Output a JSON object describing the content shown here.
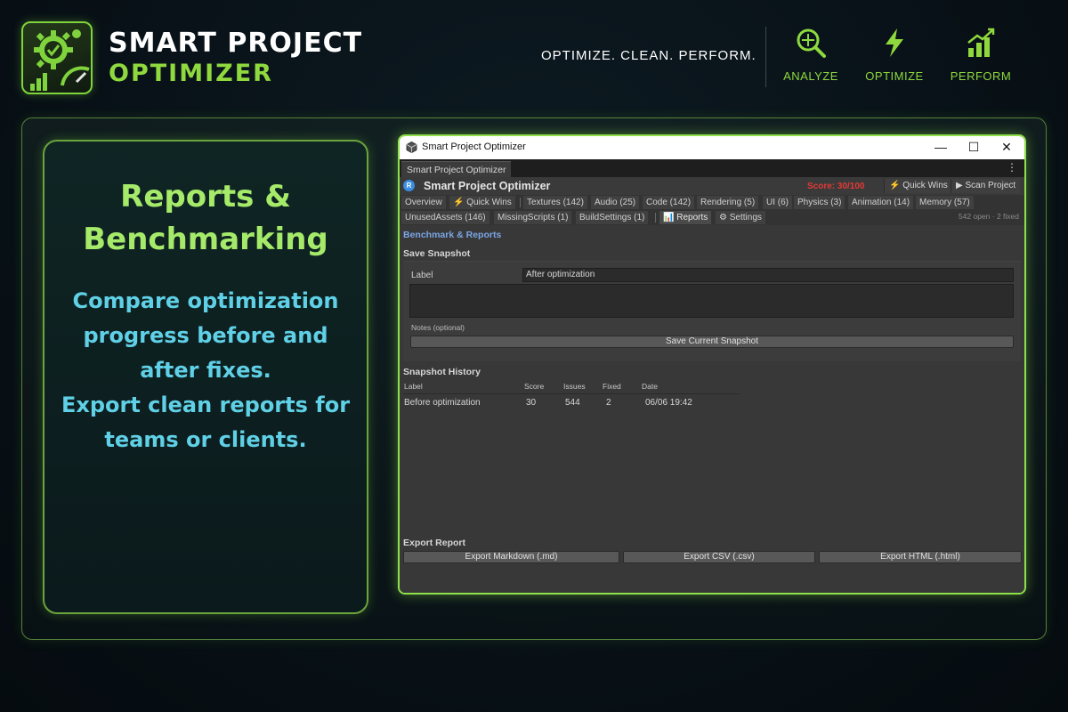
{
  "brand": {
    "name_line1": "SMART PROJECT",
    "name_line2": "OPTIMIZER",
    "tagline": "OPTIMIZE. CLEAN. PERFORM.",
    "accent_color": "#8fd93f",
    "logo_icon": "gear-check-speedometer-icon"
  },
  "features": [
    {
      "label": "ANALYZE",
      "icon": "magnifier-crosshair-icon"
    },
    {
      "label": "OPTIMIZE",
      "icon": "lightning-bolt-icon"
    },
    {
      "label": "PERFORM",
      "icon": "bar-chart-arrow-icon"
    }
  ],
  "card": {
    "title_line1": "Reports &",
    "title_line2": "Benchmarking",
    "body_lines": [
      "Compare optimization",
      "progress before and",
      "after fixes.",
      "Export clean reports for",
      "teams or clients."
    ],
    "title_color": "#a6ea6a",
    "body_color": "#5fd0e6"
  },
  "window": {
    "title": "Smart Project Optimizer",
    "controls": {
      "minimize": "—",
      "maximize": "☐",
      "close": "✕"
    },
    "tab": "Smart Project Optimizer",
    "menu_icon": "⋮",
    "toolbar": {
      "logo_letter": "R",
      "title": "Smart Project Optimizer",
      "score": "Score: 30/100",
      "score_color": "#e53935",
      "quick_wins": "⚡ Quick Wins",
      "scan": "▶ Scan Project"
    },
    "tabs_row1": [
      "Overview",
      "⚡ Quick Wins",
      "Textures (142)",
      "Audio (25)",
      "Code (142)",
      "Rendering (5)",
      "UI (6)",
      "Physics (3)",
      "Animation (14)",
      "Memory (57)"
    ],
    "tabs_row2": [
      "UnusedAssets (146)",
      "MissingScripts (1)",
      "BuildSettings (1)",
      "📊 Reports",
      "⚙ Settings"
    ],
    "status_meta": "542 open · 2 fixed",
    "section_title": "Benchmark & Reports",
    "save_snapshot": {
      "heading": "Save Snapshot",
      "label_caption": "Label",
      "label_value": "After optimization",
      "notes_caption": "Notes (optional)",
      "button": "Save Current Snapshot"
    },
    "history": {
      "heading": "Snapshot History",
      "columns": [
        "Label",
        "Score",
        "Issues",
        "Fixed",
        "Date"
      ],
      "rows": [
        [
          "Before optimization",
          "30",
          "544",
          "2",
          "06/06 19:42"
        ]
      ]
    },
    "export": {
      "heading": "Export Report",
      "buttons": [
        "Export Markdown (.md)",
        "Export CSV (.csv)",
        "Export HTML (.html)"
      ]
    }
  }
}
